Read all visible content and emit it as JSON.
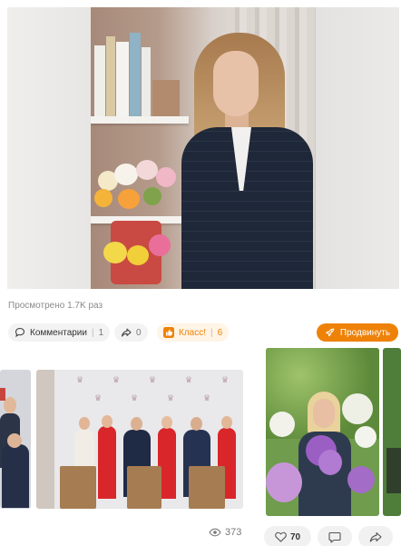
{
  "post": {
    "views_text": "Просмотрено 1.7K раз"
  },
  "actions": {
    "comments_label": "Комментарии",
    "comments_count": "1",
    "reshare_count": "0",
    "class_label": "Класс!",
    "class_count": "6",
    "promote_label": "Продвинуть"
  },
  "feed": {
    "views_count": "373",
    "likes_count": "70"
  },
  "colors": {
    "accent": "#ee8208",
    "pill_bg": "#f3f3f3",
    "muted_text": "#8a8a8a"
  },
  "icons": {
    "comment": "comment-icon",
    "reshare": "reshare-icon",
    "class": "thumbs-up-icon",
    "promote": "rocket-icon",
    "views": "eye-icon",
    "like": "heart-icon"
  }
}
